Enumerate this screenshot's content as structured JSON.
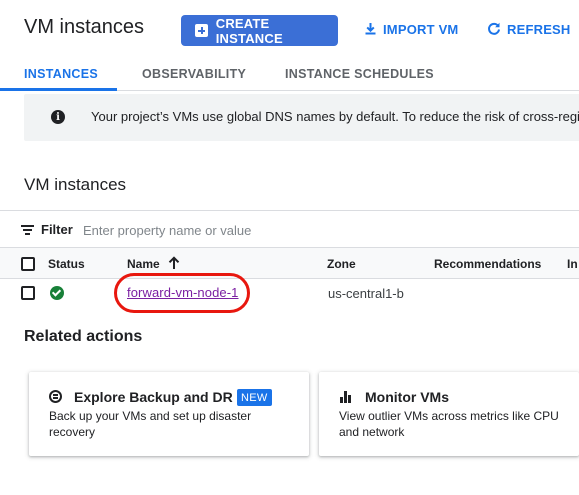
{
  "header": {
    "title": "VM instances",
    "create_label": "CREATE INSTANCE",
    "import_label": "IMPORT VM",
    "refresh_label": "REFRESH"
  },
  "tabs": [
    {
      "label": "INSTANCES",
      "active": true
    },
    {
      "label": "OBSERVABILITY",
      "active": false
    },
    {
      "label": "INSTANCE SCHEDULES",
      "active": false
    }
  ],
  "banner": {
    "icon": "info-icon",
    "text": "Your project’s VMs use global DNS names by default. To reduce the risk of cross-regi"
  },
  "section_title": "VM instances",
  "filter": {
    "label": "Filter",
    "placeholder": "Enter property name or value"
  },
  "table": {
    "columns": [
      "Status",
      "Name",
      "Zone",
      "Recommendations",
      "In"
    ],
    "sort_column": "Name",
    "rows": [
      {
        "status": "running",
        "name": "forward-vm-node-1",
        "zone": "us-central1-b",
        "recommendations": ""
      }
    ]
  },
  "related": {
    "title": "Related actions",
    "cards": [
      {
        "title": "Explore Backup and DR",
        "badge": "NEW",
        "desc_line1": "Back up your VMs and set up disaster",
        "desc_line2": "recovery"
      },
      {
        "title": "Monitor VMs",
        "desc_line1": "View outlier VMs across metrics like CPU",
        "desc_line2": "and network"
      }
    ]
  },
  "colors": {
    "accent": "#1a73e8",
    "status_ok": "#188038",
    "highlight": "#e8170e",
    "visited_link": "#7b1fa2"
  }
}
